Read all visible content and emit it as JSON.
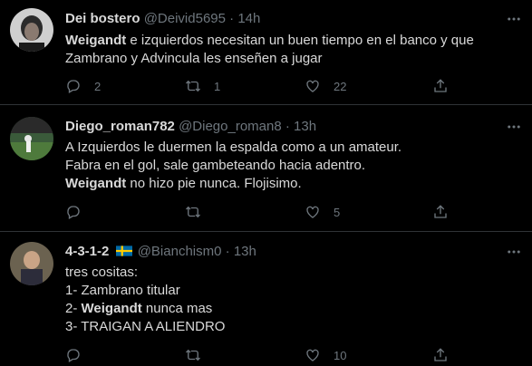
{
  "tweets": [
    {
      "name": "Dei bostero",
      "handle": "@Deivid5695",
      "dot": "·",
      "time": "14h",
      "text": [
        "",
        " e izquierdos necesitan un buen tiempo en el banco y que",
        "Zambrano y Advincula les enseñen a jugar"
      ],
      "bold_word": "Weigandt",
      "replies": "2",
      "retweets": "1",
      "likes": "22"
    },
    {
      "name": "Diego_roman782",
      "handle": "@Diego_roman8",
      "dot": "·",
      "time": "13h",
      "line1": "A Izquierdos le duermen la espalda como a un amateur.",
      "line2": "Fabra en el gol, sale gambeteando hacia adentro.",
      "bold_word": "Weigandt",
      "line3_rest": " no hizo pie nunca. Flojisimo.",
      "replies": "",
      "retweets": "",
      "likes": "5"
    },
    {
      "name": "4-3-1-2",
      "handle": "@Bianchism0",
      "dot": "·",
      "time": "13h",
      "line1": "tres cositas:",
      "line2": "1- Zambrano titular",
      "line3_pre": "2- ",
      "bold_word": "Weigandt",
      "line3_rest": " nunca mas",
      "line4": "3- TRAIGAN A ALIENDRO",
      "replies": "",
      "retweets": "",
      "likes": "10"
    }
  ],
  "colors": {
    "bg": "#000000",
    "text": "#d9d9d9",
    "muted": "#6e767d",
    "divider": "#2f3336"
  },
  "icons": [
    "reply-icon",
    "retweet-icon",
    "like-icon",
    "share-icon",
    "more-icon",
    "sweden-flag-icon"
  ]
}
